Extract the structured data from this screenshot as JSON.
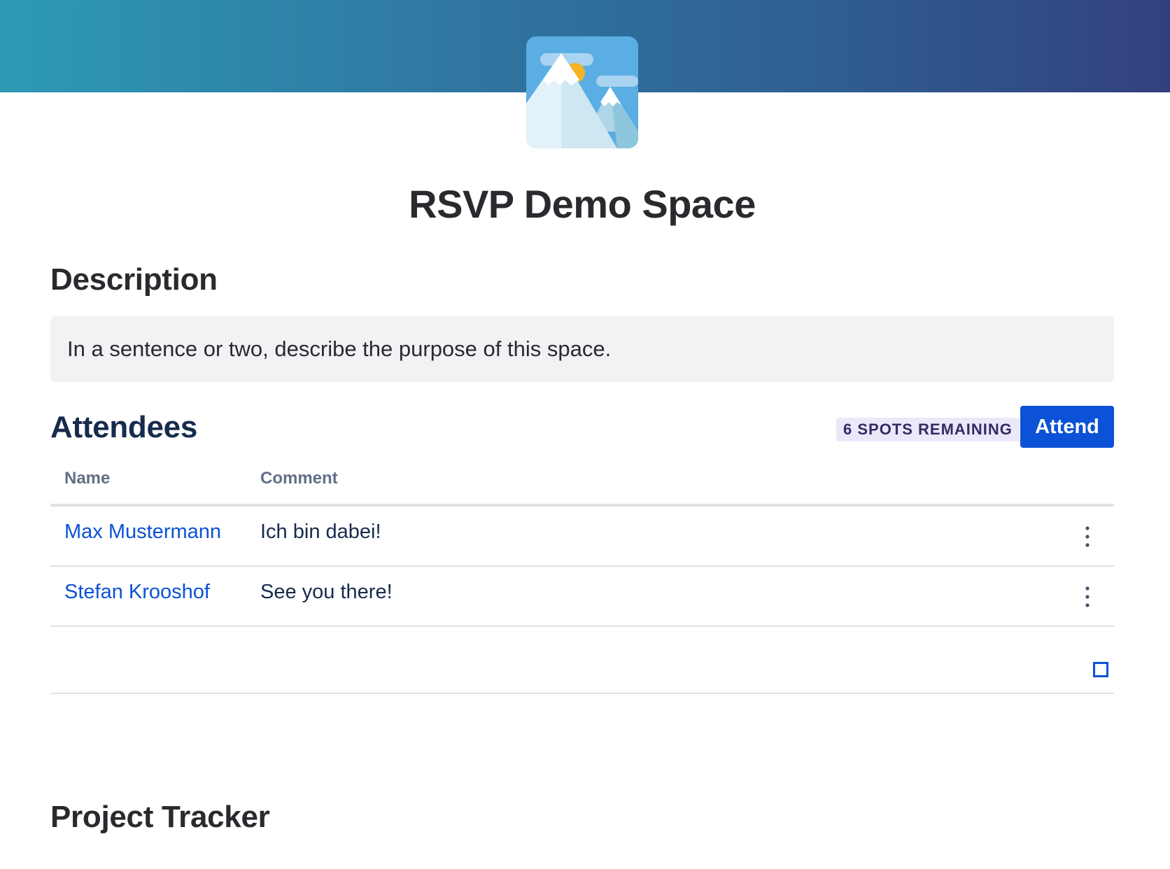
{
  "space": {
    "title": "RSVP Demo Space",
    "logo_icon": "mountain-landscape-icon"
  },
  "description": {
    "heading": "Description",
    "text": "In a sentence or two, describe the purpose of this space."
  },
  "attendees": {
    "heading": "Attendees",
    "spots_badge": "6 SPOTS REMAINING",
    "attend_label": "Attend",
    "columns": [
      "Name",
      "Comment"
    ],
    "rows": [
      {
        "name": "Max Mustermann",
        "comment": "Ich bin dabei!"
      },
      {
        "name": "Stefan Krooshof",
        "comment": "See you there!"
      }
    ],
    "row_menu_icon": "more-vertical-icon",
    "expand_icon": "expand-square-icon"
  },
  "project_tracker": {
    "heading": "Project Tracker"
  },
  "colors": {
    "banner_start": "#2d9ab2",
    "banner_end": "#32407f",
    "primary": "#0c52d6",
    "badge_bg": "#ebe8fa",
    "badge_text": "#352c63"
  }
}
